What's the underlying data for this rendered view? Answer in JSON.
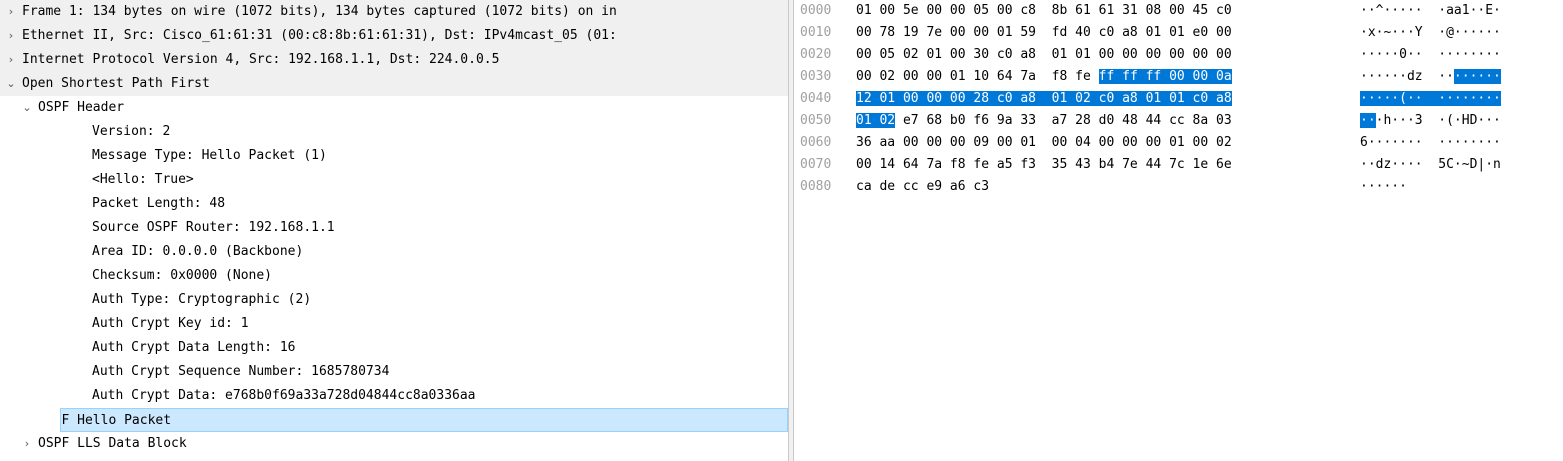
{
  "tree": [
    {
      "indent": 0,
      "arrow": "›",
      "text": "Frame 1: 134 bytes on wire (1072 bits), 134 bytes captured (1072 bits) on in",
      "style": "gray"
    },
    {
      "indent": 0,
      "arrow": "›",
      "text": "Ethernet II, Src: Cisco_61:61:31 (00:c8:8b:61:61:31), Dst: IPv4mcast_05 (01:",
      "style": "gray"
    },
    {
      "indent": 0,
      "arrow": "›",
      "text": "Internet Protocol Version 4, Src: 192.168.1.1, Dst: 224.0.0.5",
      "style": "gray"
    },
    {
      "indent": 0,
      "arrow": "⌄",
      "text": "Open Shortest Path First",
      "style": "gray"
    },
    {
      "indent": 1,
      "arrow": "⌄",
      "text": "OSPF Header",
      "style": ""
    },
    {
      "indent": 2,
      "arrow": "",
      "text": "Version: 2",
      "style": ""
    },
    {
      "indent": 2,
      "arrow": "",
      "text": "Message Type: Hello Packet (1)",
      "style": ""
    },
    {
      "indent": 2,
      "arrow": "",
      "text": "<Hello: True>",
      "style": ""
    },
    {
      "indent": 2,
      "arrow": "",
      "text": "Packet Length: 48",
      "style": ""
    },
    {
      "indent": 2,
      "arrow": "",
      "text": "Source OSPF Router: 192.168.1.1",
      "style": ""
    },
    {
      "indent": 2,
      "arrow": "",
      "text": "Area ID: 0.0.0.0 (Backbone)",
      "style": ""
    },
    {
      "indent": 2,
      "arrow": "",
      "text": "Checksum: 0x0000 (None)",
      "style": ""
    },
    {
      "indent": 2,
      "arrow": "",
      "text": "Auth Type: Cryptographic (2)",
      "style": ""
    },
    {
      "indent": 2,
      "arrow": "",
      "text": "Auth Crypt Key id: 1",
      "style": ""
    },
    {
      "indent": 2,
      "arrow": "",
      "text": "Auth Crypt Data Length: 16",
      "style": ""
    },
    {
      "indent": 2,
      "arrow": "",
      "text": "Auth Crypt Sequence Number: 1685780734",
      "style": ""
    },
    {
      "indent": 2,
      "arrow": "",
      "text": "Auth Crypt Data: e768b0f69a33a728d04844cc8a0336aa",
      "style": ""
    },
    {
      "indent": 1,
      "arrow": "›",
      "text": "OSPF Hello Packet",
      "style": "selected"
    },
    {
      "indent": 1,
      "arrow": "›",
      "text": "OSPF LLS Data Block",
      "style": ""
    }
  ],
  "hex_rows": [
    {
      "offset": "0000",
      "hex": "01 00 5e 00 00 05 00 c8  8b 61 61 31 08 00 45 c0",
      "hl": "",
      "hex_after": "",
      "ascii": "··^·····  ·aa1··E·",
      "ascii_hl": "",
      "ascii_after": ""
    },
    {
      "offset": "0010",
      "hex": "00 78 19 7e 00 00 01 59  fd 40 c0 a8 01 01 e0 00",
      "hl": "",
      "hex_after": "",
      "ascii": "·x·~···Y  ·@······",
      "ascii_hl": "",
      "ascii_after": ""
    },
    {
      "offset": "0020",
      "hex": "00 05 02 01 00 30 c0 a8  01 01 00 00 00 00 00 00",
      "hl": "",
      "hex_after": "",
      "ascii": "·····0··  ········",
      "ascii_hl": "",
      "ascii_after": ""
    },
    {
      "offset": "0030",
      "hex": "00 02 00 00 01 10 64 7a  f8 fe ",
      "hl": "ff ff ff 00 00 0a",
      "hex_after": "",
      "ascii": "······dz  ··",
      "ascii_hl": "······",
      "ascii_after": ""
    },
    {
      "offset": "0040",
      "hex": "",
      "hl": "12 01 00 00 00 28 c0 a8  01 02 c0 a8 01 01 c0 a8",
      "hex_after": "",
      "ascii": "",
      "ascii_hl": "·····(··  ········",
      "ascii_after": ""
    },
    {
      "offset": "0050",
      "hex": "",
      "hl": "01 02",
      "hex_after": " e7 68 b0 f6 9a 33  a7 28 d0 48 44 cc 8a 03",
      "ascii": "",
      "ascii_hl": "··",
      "ascii_after": "·h···3  ·(·HD···"
    },
    {
      "offset": "0060",
      "hex": "36 aa 00 00 00 09 00 01  00 04 00 00 00 01 00 02",
      "hl": "",
      "hex_after": "",
      "ascii": "6·······  ········",
      "ascii_hl": "",
      "ascii_after": ""
    },
    {
      "offset": "0070",
      "hex": "00 14 64 7a f8 fe a5 f3  35 43 b4 7e 44 7c 1e 6e",
      "hl": "",
      "hex_after": "",
      "ascii": "··dz····  5C·~D|·n",
      "ascii_hl": "",
      "ascii_after": ""
    },
    {
      "offset": "0080",
      "hex": "ca de cc e9 a6 c3",
      "hl": "",
      "hex_after": "",
      "ascii": "······",
      "ascii_hl": "",
      "ascii_after": ""
    }
  ]
}
